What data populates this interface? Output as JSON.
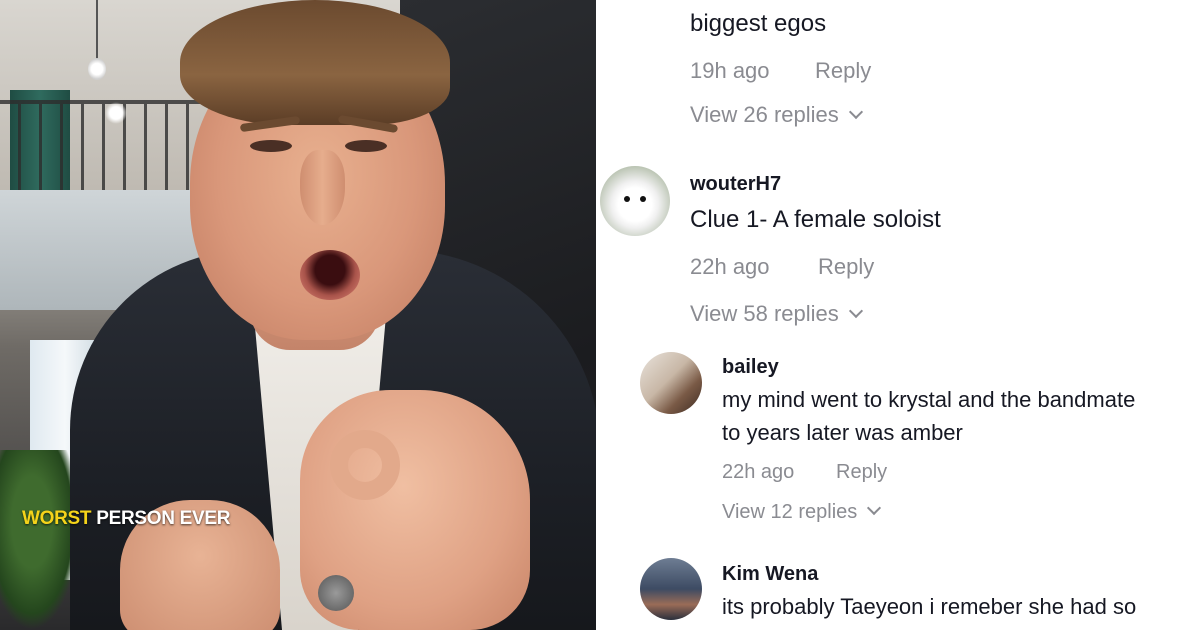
{
  "video": {
    "caption_highlight": "WORST",
    "caption_rest": " PERSON EVER"
  },
  "comments": {
    "partial_top": {
      "text": "biggest egos",
      "time": "19h ago",
      "reply": "Reply",
      "view_replies": "View 26 replies"
    },
    "items": [
      {
        "username": "wouterH7",
        "text": "Clue 1- A female soloist",
        "time": "22h ago",
        "reply": "Reply",
        "view_replies": "View 58 replies",
        "avatar": "white-dog-avatar"
      },
      {
        "username": "bailey",
        "text_line1": "my mind went to krystal and the bandmate",
        "text_line2": "to years later was amber",
        "time": "22h ago",
        "reply": "Reply",
        "view_replies": "View 12 replies",
        "avatar": "user-photo-avatar"
      },
      {
        "username": "Kim Wena",
        "text": "its probably Taeyeon i remeber she had so",
        "avatar": "user-photo-avatar"
      }
    ]
  },
  "colors": {
    "caption_highlight": "#f5d31a",
    "muted_text": "#8a8b91",
    "primary_text": "#161823"
  }
}
